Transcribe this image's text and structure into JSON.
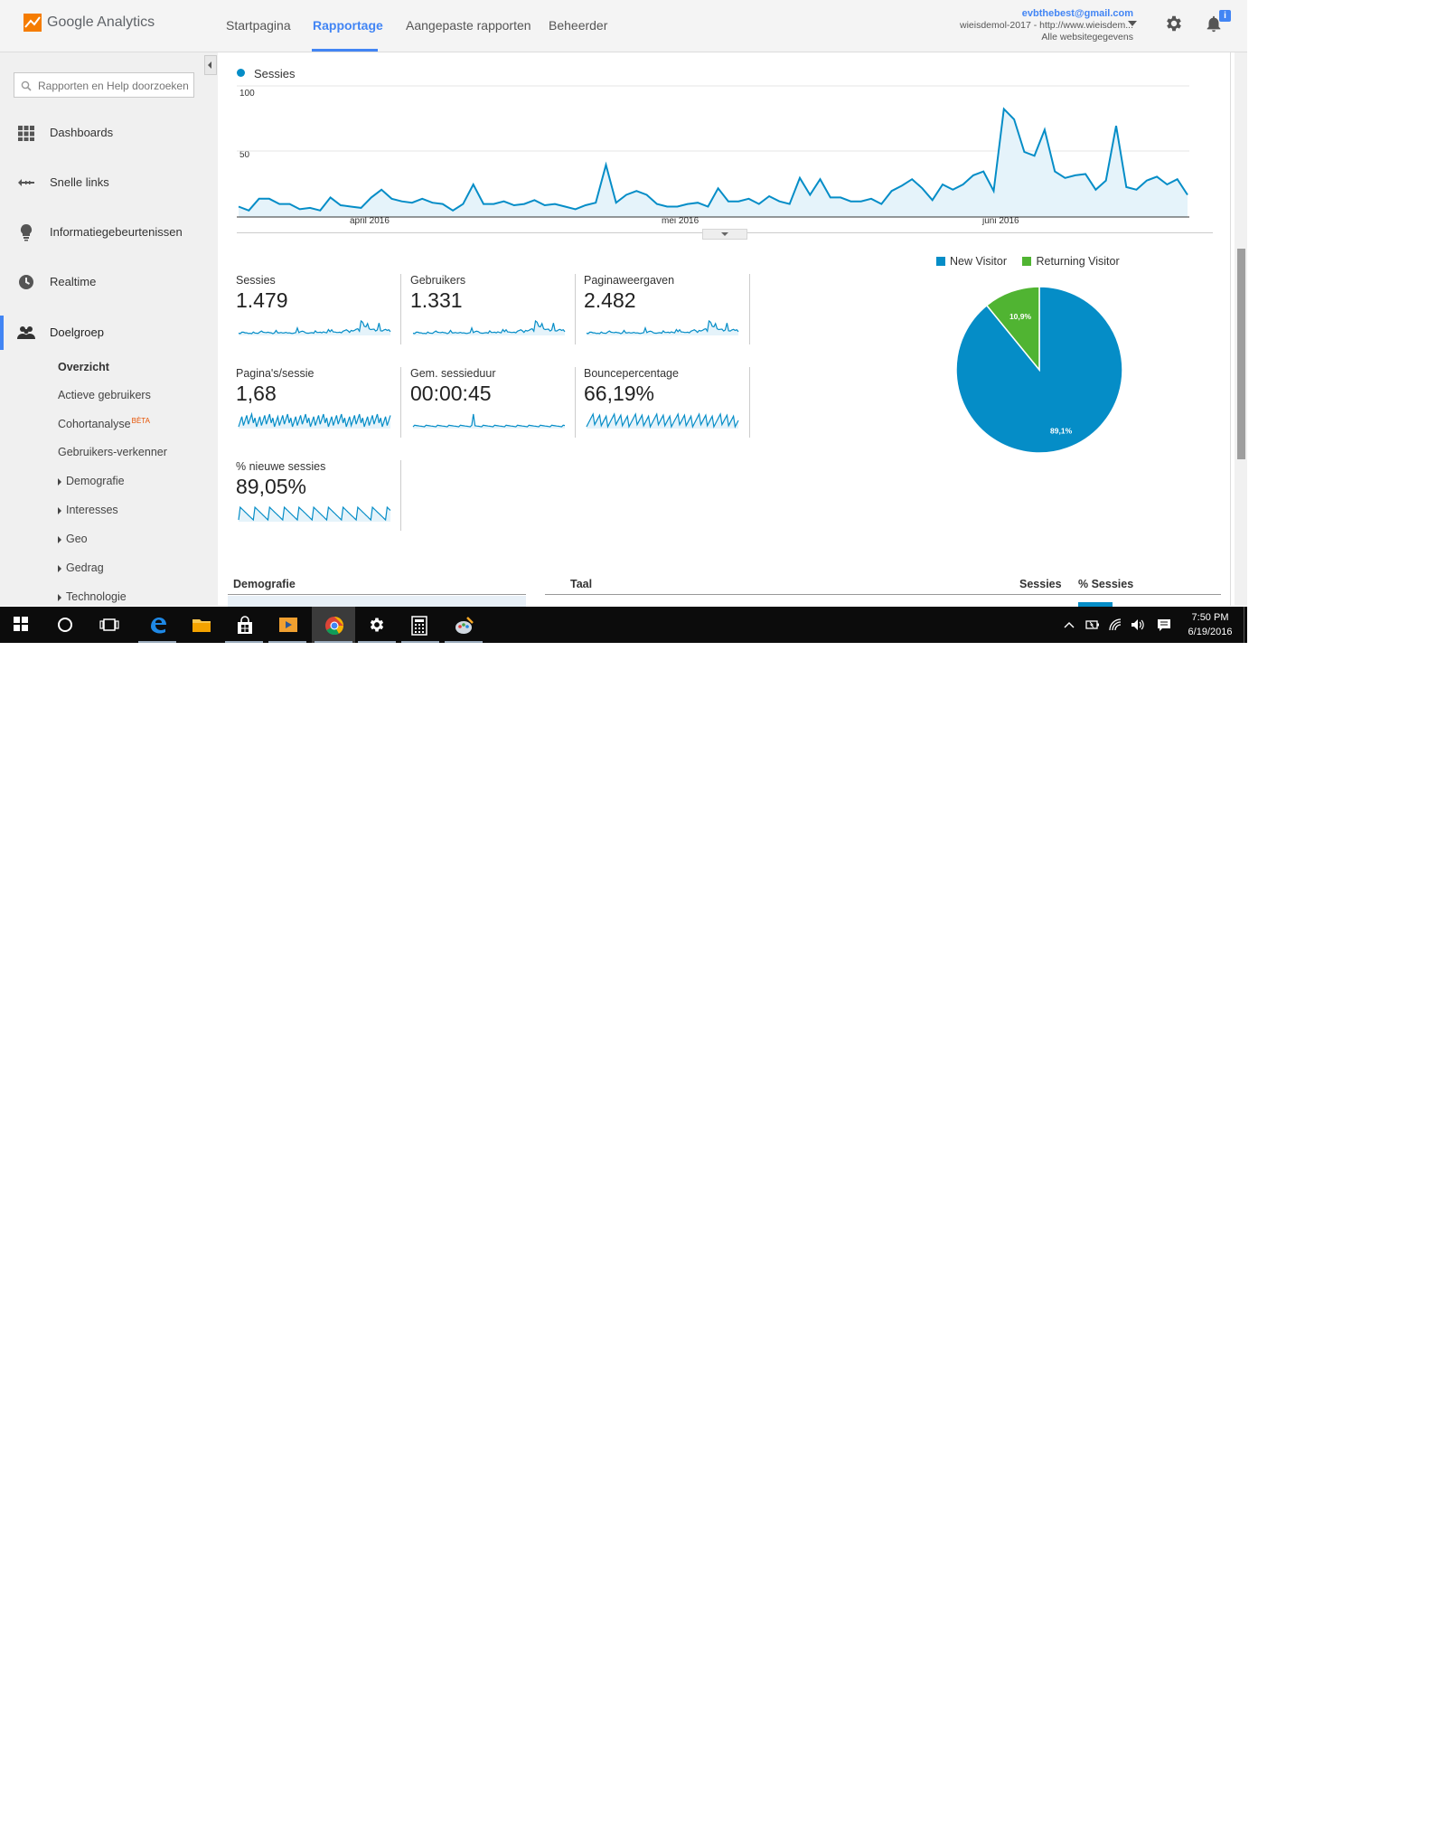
{
  "header": {
    "app_name": "Google Analytics",
    "nav": [
      "Startpagina",
      "Rapportage",
      "Aangepaste rapporten",
      "Beheerder"
    ],
    "active_nav": "Rapportage",
    "account_email": "evbthebest@gmail.com",
    "account_property": "wieisdemol-2017 - http://www.wieisdem...",
    "account_view": "Alle websitegegevens",
    "notification_badge": "i"
  },
  "sidebar": {
    "search_placeholder": "Rapporten en Help doorzoeken",
    "items": [
      "Dashboards",
      "Snelle links",
      "Informatiegebeurtenissen",
      "Realtime",
      "Doelgroep"
    ],
    "sub_items": {
      "overzicht": "Overzicht",
      "actieve": "Actieve gebruikers",
      "cohort": "Cohortanalyse",
      "cohort_badge": "BÈTA",
      "verkenner": "Gebruikers-verkenner",
      "demografie": "Demografie",
      "interesses": "Interesses",
      "geo": "Geo",
      "gedrag": "Gedrag",
      "technologie": "Technologie"
    }
  },
  "chart_data": [
    {
      "type": "area",
      "series": [
        {
          "name": "Sessies",
          "values": [
            8,
            5,
            14,
            14,
            10,
            10,
            6,
            7,
            5,
            15,
            9,
            8,
            7,
            15,
            21,
            14,
            12,
            11,
            14,
            11,
            10,
            5,
            10,
            25,
            10,
            10,
            12,
            9,
            10,
            13,
            9,
            10,
            8,
            6,
            9,
            11,
            40,
            11,
            17,
            20,
            17,
            10,
            8,
            8,
            10,
            11,
            8,
            22,
            12,
            12,
            14,
            10,
            16,
            12,
            10,
            30,
            17,
            29,
            15,
            15,
            12,
            12,
            14,
            10,
            20,
            24,
            29,
            22,
            13,
            25,
            21,
            25,
            32,
            35,
            20,
            83,
            75,
            50,
            47,
            67,
            35,
            30,
            32,
            33,
            21,
            28,
            70,
            23,
            21,
            28,
            31,
            25,
            29,
            17
          ]
        }
      ],
      "x_labels": [
        "april 2016",
        "mei 2016",
        "juni 2016"
      ],
      "y_ticks": [
        100,
        50
      ],
      "ylim": [
        0,
        100
      ],
      "color": "#058dc7"
    },
    {
      "type": "pie",
      "categories": [
        "New Visitor",
        "Returning Visitor"
      ],
      "values": [
        89.1,
        10.9
      ],
      "labels": [
        "89,1%",
        "10,9%"
      ],
      "colors": [
        "#058dc7",
        "#50b432"
      ]
    }
  ],
  "metrics": [
    {
      "label": "Sessies",
      "value": "1.479"
    },
    {
      "label": "Gebruikers",
      "value": "1.331"
    },
    {
      "label": "Paginaweergaven",
      "value": "2.482"
    },
    {
      "label": "Pagina's/sessie",
      "value": "1,68"
    },
    {
      "label": "Gem. sessieduur",
      "value": "00:00:45"
    },
    {
      "label": "Bouncepercentage",
      "value": "66,19%"
    },
    {
      "label": "% nieuwe sessies",
      "value": "89,05%"
    }
  ],
  "tables": {
    "demografie_header": "Demografie",
    "taal_header": "Taal",
    "sessies_header": "Sessies",
    "pct_sessies_header": "% Sessies"
  },
  "taskbar": {
    "time": "7:50 PM",
    "date": "6/19/2016",
    "icons": [
      "windows-start-icon",
      "cortana-icon",
      "task-view-icon",
      "edge-icon",
      "file-explorer-icon",
      "store-icon",
      "media-player-icon",
      "chrome-icon",
      "settings-icon",
      "calculator-icon",
      "paint-icon"
    ]
  },
  "colors": {
    "accent": "#4285f4",
    "series": "#058dc7",
    "returning": "#50b432"
  }
}
